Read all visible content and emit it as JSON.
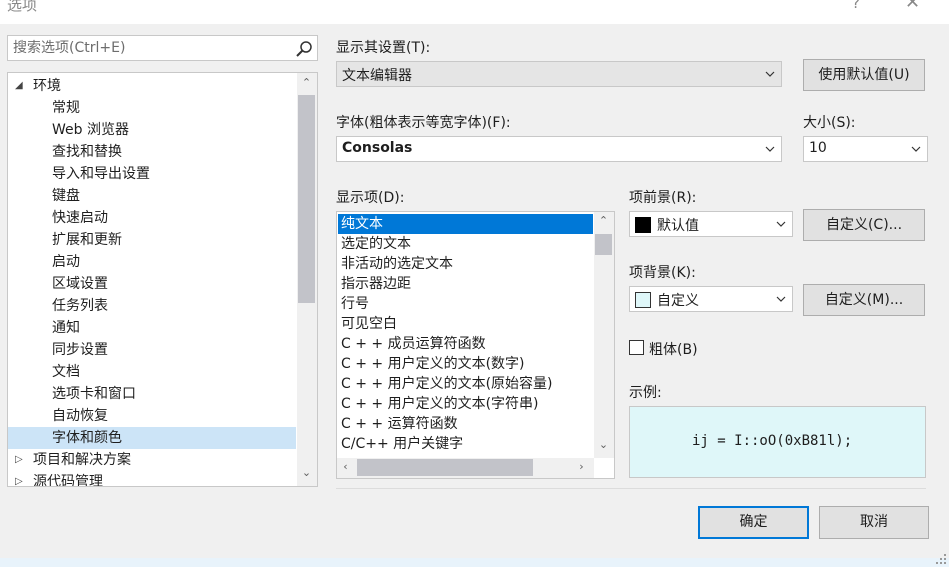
{
  "window": {
    "title": "选项",
    "help": "?",
    "close": "✕"
  },
  "search": {
    "placeholder": "搜索选项(Ctrl+E)"
  },
  "tree": {
    "items": [
      {
        "label": "环境",
        "expanded": true,
        "level": 0
      },
      {
        "label": "常规",
        "level": 1
      },
      {
        "label": "Web 浏览器",
        "level": 1
      },
      {
        "label": "查找和替换",
        "level": 1
      },
      {
        "label": "导入和导出设置",
        "level": 1
      },
      {
        "label": "键盘",
        "level": 1
      },
      {
        "label": "快速启动",
        "level": 1
      },
      {
        "label": "扩展和更新",
        "level": 1
      },
      {
        "label": "启动",
        "level": 1
      },
      {
        "label": "区域设置",
        "level": 1
      },
      {
        "label": "任务列表",
        "level": 1
      },
      {
        "label": "通知",
        "level": 1
      },
      {
        "label": "同步设置",
        "level": 1
      },
      {
        "label": "文档",
        "level": 1
      },
      {
        "label": "选项卡和窗口",
        "level": 1
      },
      {
        "label": "自动恢复",
        "level": 1
      },
      {
        "label": "字体和颜色",
        "level": 1,
        "selected": true
      },
      {
        "label": "项目和解决方案",
        "expanded": false,
        "level": 0
      },
      {
        "label": "源代码管理",
        "expanded": false,
        "level": 0
      }
    ]
  },
  "show_settings": {
    "label": "显示其设置(T):",
    "value": "文本编辑器"
  },
  "use_defaults_button": "使用默认值(U)",
  "font": {
    "label": "字体(粗体表示等宽字体)(F):",
    "value": "Consolas"
  },
  "size": {
    "label": "大小(S):",
    "value": "10"
  },
  "display_items": {
    "label": "显示项(D):",
    "items": [
      {
        "label": "纯文本",
        "selected": true
      },
      {
        "label": "选定的文本"
      },
      {
        "label": "非活动的选定文本"
      },
      {
        "label": "指示器边距"
      },
      {
        "label": "行号"
      },
      {
        "label": "可见空白"
      },
      {
        "label": "C + + 成员运算符函数"
      },
      {
        "label": "C + + 用户定义的文本(数字)"
      },
      {
        "label": "C + + 用户定义的文本(原始容量)"
      },
      {
        "label": "C + + 用户定义的文本(字符串)"
      },
      {
        "label": "C + + 运算符函数"
      },
      {
        "label": "C/C++ 用户关键字"
      }
    ]
  },
  "foreground": {
    "label": "项前景(R):",
    "value": "默认值",
    "swatch_color": "#000000",
    "custom_button": "自定义(C)..."
  },
  "background": {
    "label": "项背景(K):",
    "value": "自定义",
    "swatch_color": "#dff7f9",
    "custom_button": "自定义(M)..."
  },
  "bold": {
    "label": "粗体(B)",
    "checked": false
  },
  "sample": {
    "label": "示例:",
    "text": "ij = I::oO(0xB81l);",
    "background_color": "#dff7f9"
  },
  "ok_button": "确定",
  "cancel_button": "取消",
  "colors": {
    "accent": "#0078d7",
    "selection_light": "#cce4f7"
  }
}
